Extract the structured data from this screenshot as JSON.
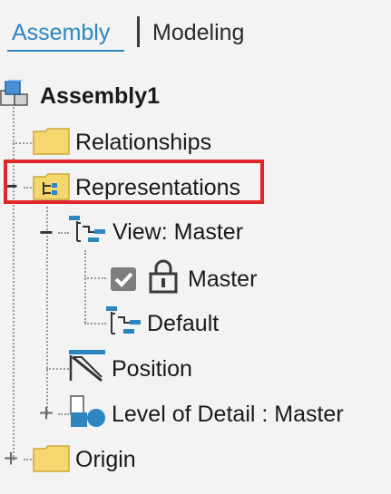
{
  "tabs": {
    "assembly": "Assembly",
    "modeling": "Modeling"
  },
  "tree": {
    "root": {
      "label": "Assembly1",
      "icon": "assembly-icon"
    },
    "relationships": {
      "label": "Relationships",
      "icon": "folder-icon"
    },
    "representations": {
      "label": "Representations",
      "icon": "representations-folder-icon",
      "expander": "−"
    },
    "view_master": {
      "label": "View: Master",
      "icon": "view-rep-icon",
      "expander": "−"
    },
    "master": {
      "label": "Master",
      "icons": [
        "checkbox-checked-icon",
        "lock-icon"
      ]
    },
    "default": {
      "label": "Default",
      "icon": "view-rep-icon"
    },
    "position": {
      "label": "Position",
      "icon": "position-icon"
    },
    "level_of_detail": {
      "label": "Level of Detail : Master",
      "icon": "level-of-detail-icon",
      "expander": "+"
    },
    "origin": {
      "label": "Origin",
      "icon": "folder-icon",
      "expander": "+"
    }
  },
  "colors": {
    "accent": "#2e86c1",
    "highlight": "#e0252b",
    "folder": "#f5d76e"
  }
}
